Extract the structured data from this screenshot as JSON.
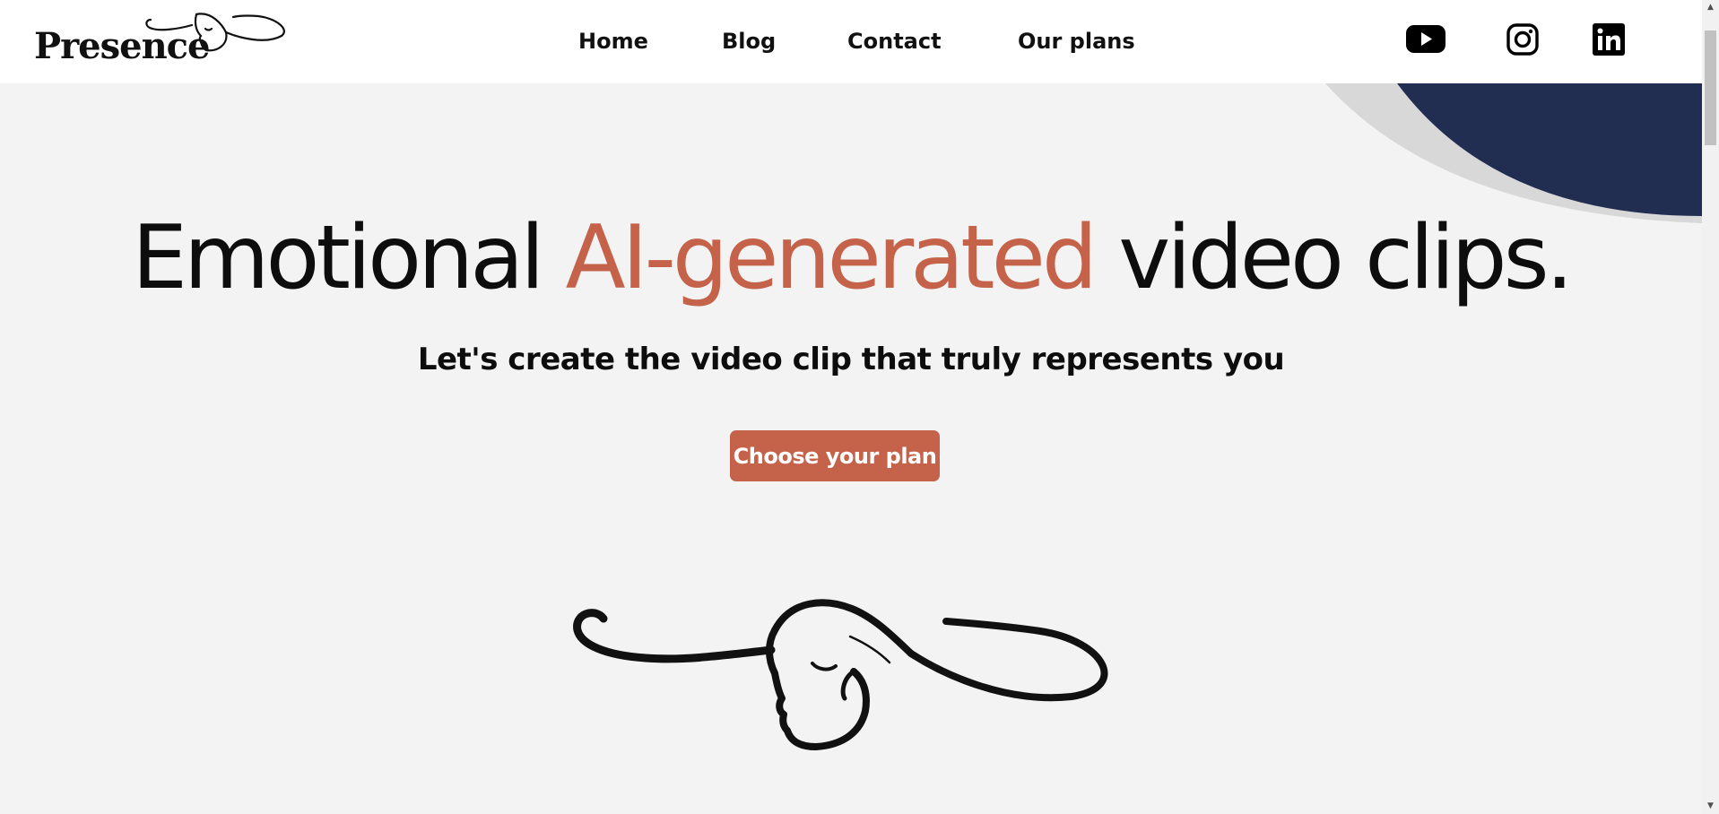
{
  "header": {
    "logo_text": "Presence",
    "nav": [
      {
        "label": "Home"
      },
      {
        "label": "Blog"
      },
      {
        "label": "Contact"
      },
      {
        "label": "Our plans"
      }
    ],
    "social": [
      {
        "icon": "youtube-icon"
      },
      {
        "icon": "instagram-icon"
      },
      {
        "icon": "linkedin-icon"
      }
    ]
  },
  "hero": {
    "title_part1": "Emotional ",
    "title_accent": "AI-generated",
    "title_part2": " video clips.",
    "subtitle": "Let's create the video clip that truly represents you",
    "cta_label": "Choose your plan"
  },
  "colors": {
    "accent": "#c5624a",
    "navy": "#212e52",
    "page_bg": "#f3f3f3",
    "header_bg": "#ffffff"
  }
}
